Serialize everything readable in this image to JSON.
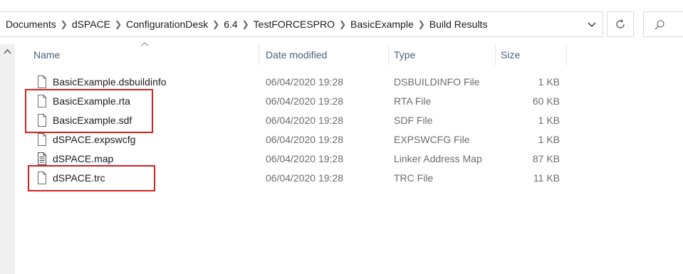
{
  "breadcrumb": [
    "Documents",
    "dSPACE",
    "ConfigurationDesk",
    "6.4",
    "TestFORCESPRO",
    "BasicExample",
    "Build Results"
  ],
  "toolbar": {
    "dropdown_icon": "chevron-down-icon",
    "refresh_icon": "refresh-icon",
    "search_icon": "search-icon"
  },
  "columns": {
    "name": "Name",
    "date": "Date modified",
    "type": "Type",
    "size": "Size"
  },
  "files": [
    {
      "name": "BasicExample.dsbuildinfo",
      "date": "06/04/2020 19:28",
      "type": "DSBUILDINFO File",
      "size": "1 KB",
      "icon": "file-icon"
    },
    {
      "name": "BasicExample.rta",
      "date": "06/04/2020 19:28",
      "type": "RTA File",
      "size": "60 KB",
      "icon": "file-icon"
    },
    {
      "name": "BasicExample.sdf",
      "date": "06/04/2020 19:28",
      "type": "SDF File",
      "size": "1 KB",
      "icon": "file-icon"
    },
    {
      "name": "dSPACE.expswcfg",
      "date": "06/04/2020 19:28",
      "type": "EXPSWCFG File",
      "size": "1 KB",
      "icon": "file-icon"
    },
    {
      "name": "dSPACE.map",
      "date": "06/04/2020 19:28",
      "type": "Linker Address Map",
      "size": "87 KB",
      "icon": "text-file-icon"
    },
    {
      "name": "dSPACE.trc",
      "date": "06/04/2020 19:28",
      "type": "TRC File",
      "size": "11 KB",
      "icon": "file-icon"
    }
  ],
  "colors": {
    "highlight": "#d42020",
    "header_text": "#4c607a"
  }
}
